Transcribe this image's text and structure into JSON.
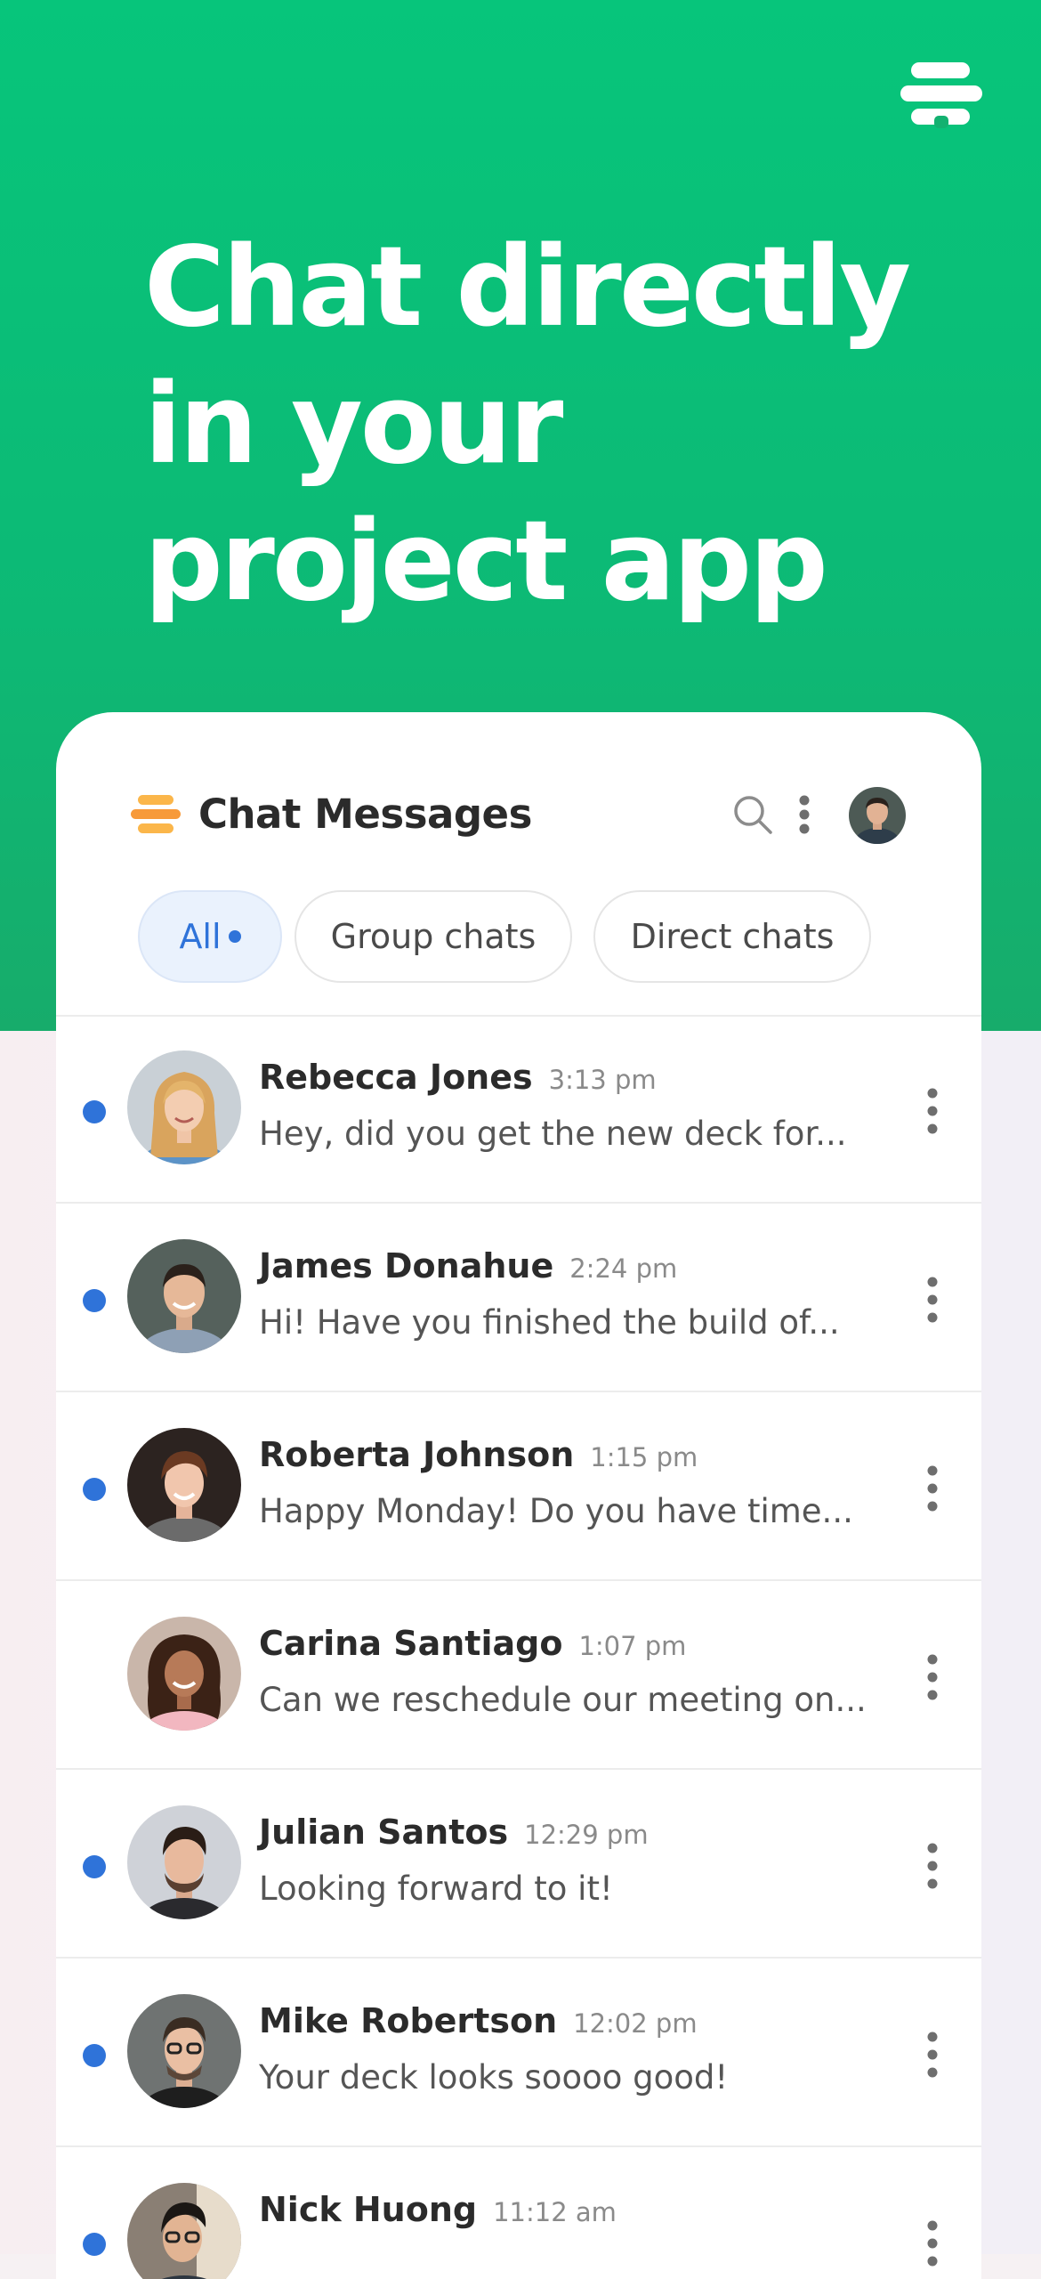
{
  "hero": {
    "logo_icon": "brand-logo-icon",
    "headline_lines": [
      "Chat directly",
      "in your",
      "project app"
    ],
    "background_color": "#07c57b"
  },
  "card": {
    "title": "Chat Messages",
    "logo_icon": "brand-logo-icon",
    "search_icon": "search-icon",
    "more_icon": "more-vertical-icon",
    "filters": [
      {
        "label": "All",
        "active": true
      },
      {
        "label": "Group chats",
        "active": false
      },
      {
        "label": "Direct chats",
        "active": false
      }
    ],
    "accent_color": "#2f73d9"
  },
  "chats": [
    {
      "name": "Rebecca Jones",
      "time": "3:13 pm",
      "preview": "Hey, did you get the new deck for...",
      "unread": true
    },
    {
      "name": "James Donahue",
      "time": "2:24 pm",
      "preview": "Hi! Have you finished the build of...",
      "unread": true
    },
    {
      "name": "Roberta Johnson",
      "time": "1:15 pm",
      "preview": "Happy Monday! Do you have time...",
      "unread": true
    },
    {
      "name": "Carina Santiago",
      "time": "1:07 pm",
      "preview": "Can we reschedule our meeting on...",
      "unread": false
    },
    {
      "name": "Julian Santos",
      "time": "12:29 pm",
      "preview": "Looking forward to it!",
      "unread": true
    },
    {
      "name": "Mike Robertson",
      "time": "12:02 pm",
      "preview": "Your deck looks soooo good!",
      "unread": true
    },
    {
      "name": "Nick Huong",
      "time": "11:12 am",
      "preview": "",
      "unread": true
    }
  ]
}
